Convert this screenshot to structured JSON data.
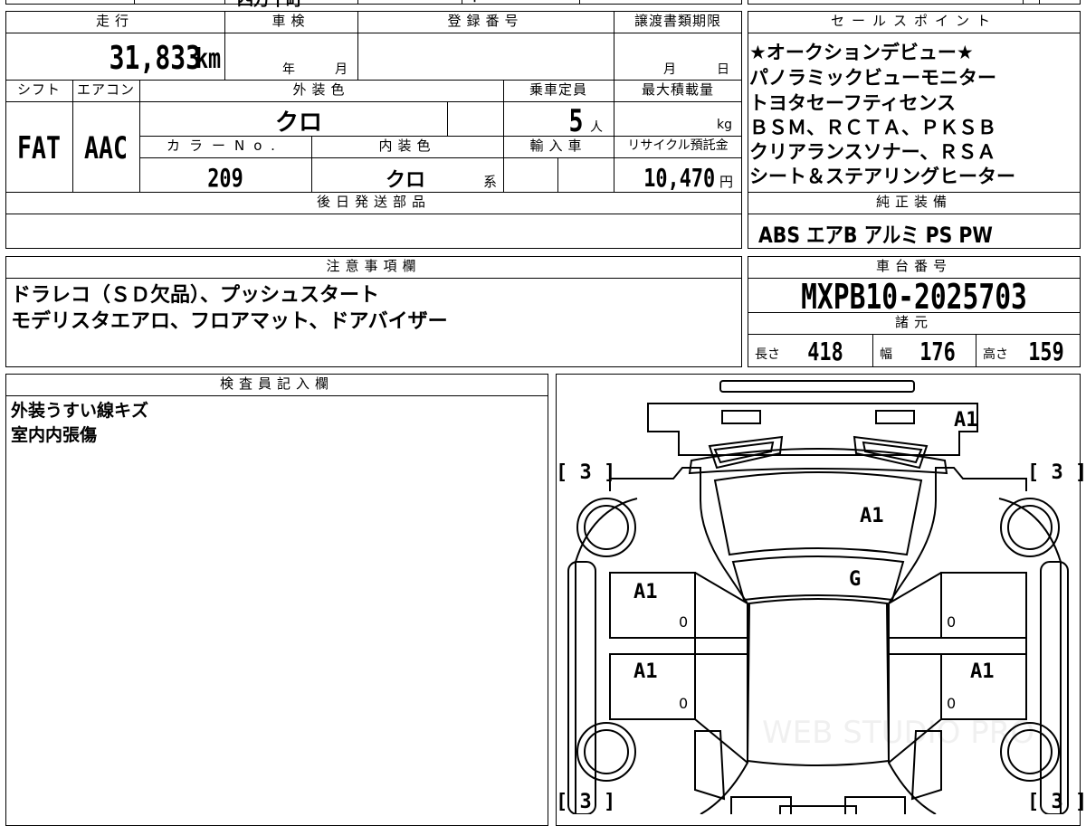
{
  "top_fragments": [
    "四万十町",
    "ㅣ"
  ],
  "headers": {
    "mileage": "走行",
    "inspection": "車検",
    "registration": "登録番号",
    "transfer_deadline": "譲渡書類期限",
    "sales_points": "セールスポイント",
    "shift": "シフト",
    "aircon": "エアコン",
    "exterior_color": "外装色",
    "capacity": "乗車定員",
    "max_load": "最大積載量",
    "color_no": "カラーNo.",
    "interior_color": "内装色",
    "import": "輸入車",
    "recycle_fee": "リサイクル預託金",
    "later_parts": "後日発送部品",
    "genuine_equipment": "純正装備",
    "notes": "注意事項欄",
    "chassis_no": "車台番号",
    "specs": "諸元",
    "inspector": "検査員記入欄"
  },
  "values": {
    "mileage": "31,833",
    "mileage_unit": "km",
    "year_unit": "年",
    "month_unit": "月",
    "day_unit": "日",
    "shift": "FAT",
    "aircon": "AAC",
    "exterior_color": "クロ",
    "capacity": "5",
    "capacity_unit": "人",
    "load_unit": "kg",
    "color_no": "209",
    "interior_color": "クロ",
    "interior_suffix": "系",
    "recycle_fee": "10,470",
    "yen": "円",
    "chassis_no": "MXPB10-2025703",
    "spec_length_label": "長さ",
    "spec_length": "418",
    "spec_width_label": "幅",
    "spec_width": "176",
    "spec_height_label": "高さ",
    "spec_height": "159"
  },
  "sales_points": [
    "★オークションデビュー★",
    "パノラミックビューモニター",
    "トヨタセーフティセンス",
    "ＢＳＭ、ＲＣＴＡ、ＰＫＳＢ",
    "クリアランスソナー、ＲＳＡ",
    "シート＆ステアリングヒーター"
  ],
  "genuine_equipment": "ABS エアB アルミ PS PW",
  "notes": [
    "ドラレコ（ＳＤ欠品）、プッシュスタート",
    "モデリスタエアロ、フロアマット、ドアバイザー"
  ],
  "inspector_notes": [
    "外装うすい線キズ",
    "室内内張傷"
  ],
  "diagram": {
    "marks": {
      "rear": "A1",
      "roof": "A1",
      "glass": "G",
      "left_front_door": "A1",
      "left_rear_door": "A1",
      "right_rear_door": "A1",
      "zero": "0"
    },
    "tire_bracket": "[ 3 ]",
    "watermark": "WEB STUDIO PRO"
  }
}
